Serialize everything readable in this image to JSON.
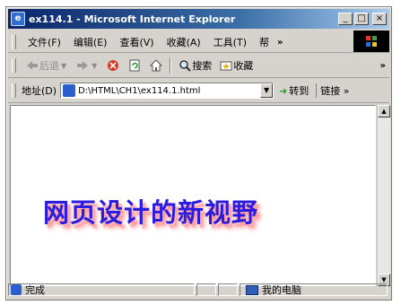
{
  "window": {
    "title": "ex114.1 - Microsoft Internet Explorer",
    "icon": "ie-page-icon"
  },
  "caption_buttons": {
    "minimize": "_",
    "maximize": "□",
    "close": "×"
  },
  "menubar": {
    "items": [
      "文件(F)",
      "编辑(E)",
      "查看(V)",
      "收藏(A)",
      "工具(T)",
      "帮"
    ],
    "more": "»"
  },
  "toolbar": {
    "back_label": "后退",
    "search_label": "搜索",
    "favorites_label": "收藏",
    "more": "»"
  },
  "addressbar": {
    "label": "地址(D)",
    "url": "D:\\HTML\\CH1\\ex114.1.html",
    "go_label": "转到",
    "links_label": "链接 »"
  },
  "page": {
    "headline": "网页设计的新视野",
    "headline_color": "#2a1ce0",
    "shadow_color": "#ff9a9a"
  },
  "statusbar": {
    "status_text": "完成",
    "zone_text": "我的电脑"
  }
}
